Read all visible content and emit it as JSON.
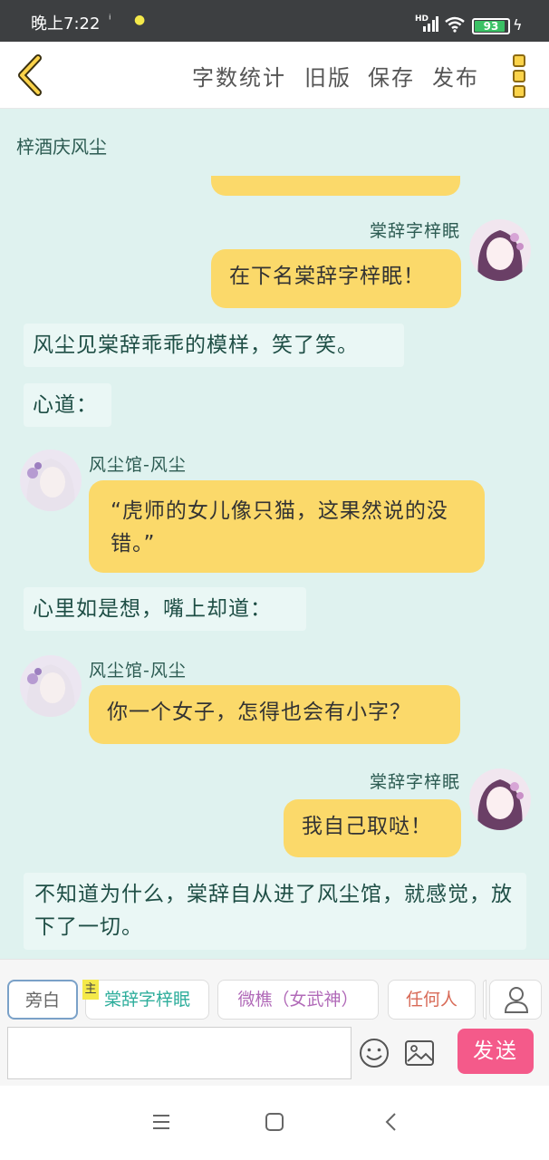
{
  "status": {
    "time": "晚上7:22",
    "hd": "HD",
    "battery": "93",
    "battery_level": 0.93
  },
  "toolbar": {
    "word_count": "字数统计",
    "old_version": "旧版",
    "save": "保存",
    "publish": "发布"
  },
  "chat": {
    "title": "梓酒庆风尘",
    "messages": [
      {
        "type": "right",
        "name": "棠辞字梓眠",
        "text": "在下名棠辞字梓眠！"
      },
      {
        "type": "narration",
        "text": "风尘见棠辞乖乖的模样，笑了笑。"
      },
      {
        "type": "narration",
        "text": "心道："
      },
      {
        "type": "left",
        "name": "风尘馆-风尘",
        "text": "“虎师的女儿像只猫，这果然说的没错。”"
      },
      {
        "type": "narration",
        "text": "心里如是想，嘴上却道："
      },
      {
        "type": "left",
        "name": "风尘馆-风尘",
        "text": "你一个女子，怎得也会有小字？"
      },
      {
        "type": "right",
        "name": "棠辞字梓眠",
        "text": "我自己取哒！"
      },
      {
        "type": "narration",
        "text": "不知道为什么，棠辞自从进了风尘馆，就感觉，放下了一切。"
      }
    ]
  },
  "roles": {
    "narrator": "旁白",
    "main_tag": "主",
    "role1": "棠辞字梓眠",
    "role2": "微樵（女武神）",
    "role3": "任何人"
  },
  "input": {
    "placeholder": "",
    "send": "发送"
  },
  "colors": {
    "accent_yellow": "#fbd96a",
    "chat_bg": "#dff2ef",
    "send_pink": "#f45a8a"
  }
}
